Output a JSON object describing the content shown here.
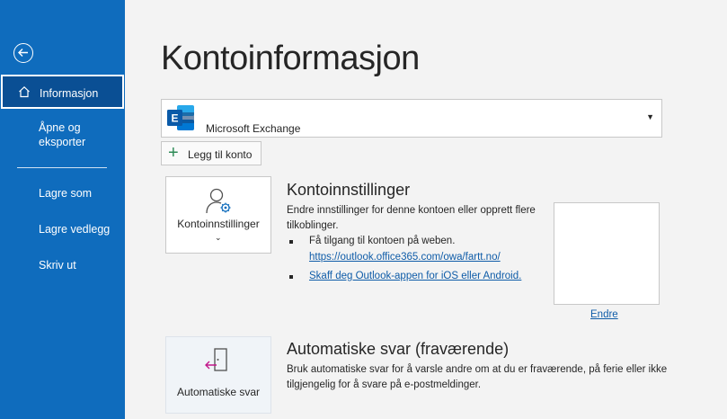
{
  "sidebar": {
    "back_icon": "arrow-left-circle-icon",
    "items": [
      {
        "label": "Informasjon",
        "icon": "home-icon",
        "active": true
      },
      {
        "label": "Åpne og eksporter"
      },
      {
        "label": "Lagre som"
      },
      {
        "label": "Lagre vedlegg"
      },
      {
        "label": "Skriv ut"
      }
    ]
  },
  "main": {
    "title": "Kontoinformasjon",
    "account": {
      "name": "Microsoft Exchange",
      "icon": "exchange-icon"
    },
    "add_account_label": "Legg til konto",
    "settings": {
      "tile_label": "Kontoinnstillinger",
      "heading": "Kontoinnstillinger",
      "description": "Endre innstillinger for denne kontoen eller opprett flere tilkoblinger.",
      "bullet1": "Få tilgang til kontoen på weben.",
      "link1": "https://outlook.office365.com/owa/fartt.no/",
      "link2": "Skaff deg Outlook-appen for iOS eller Android.",
      "change_label": "Endre"
    },
    "auto_reply": {
      "tile_label": "Automatiske svar",
      "heading": "Automatiske svar (fraværende)",
      "description": "Bruk automatiske svar for å varsle andre om at du er fraværende, på ferie eller ikke tilgjengelig for å svare på e-postmeldinger."
    }
  },
  "colors": {
    "sidebar": "#0f6cbd",
    "sidebar_active": "#0a4f94",
    "link": "#0f5ca8",
    "background": "#f3f3f3"
  }
}
